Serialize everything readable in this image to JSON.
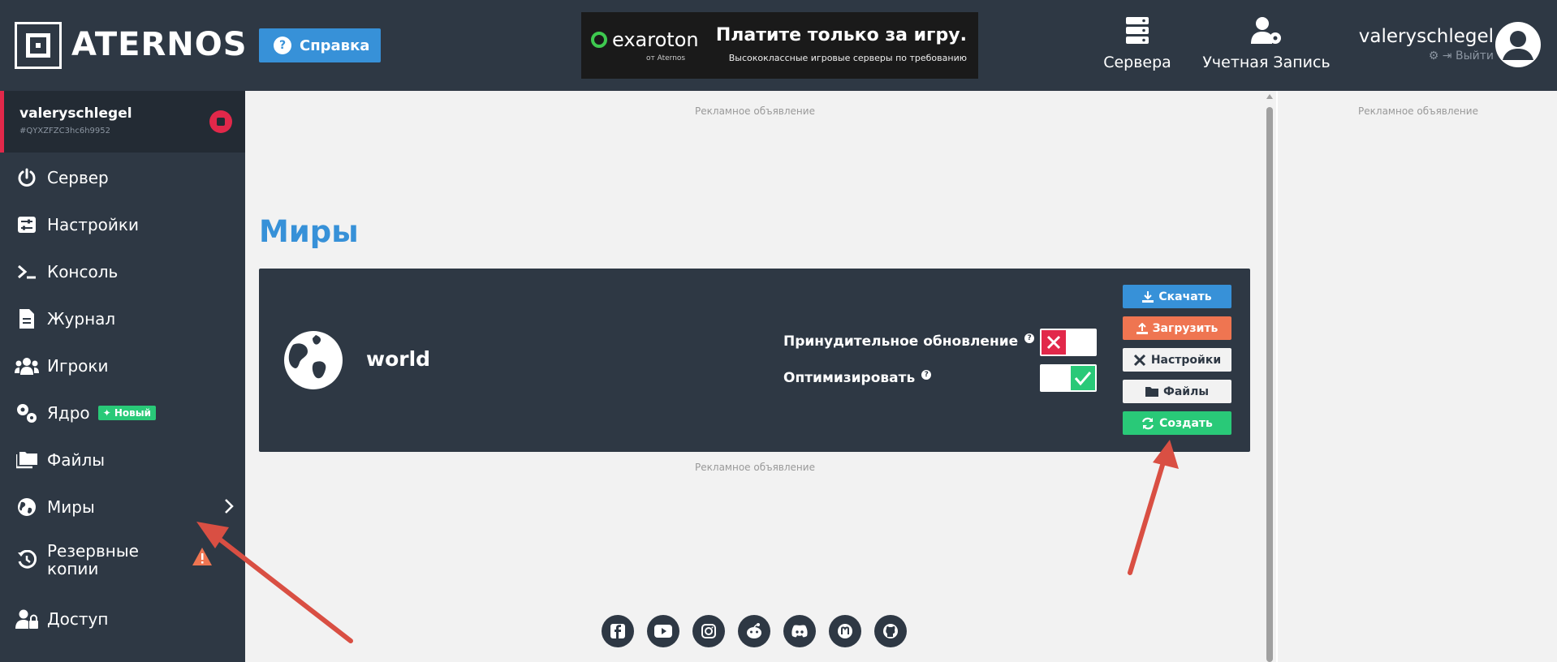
{
  "header": {
    "logo_text": "ATERNOS",
    "help_label": "Справка",
    "banner": {
      "brand": "exaroton",
      "brand_sub": "от Aternos",
      "title": "Платите только за игру.",
      "desc": "Высококлассные игровые серверы по требованию"
    },
    "nav": {
      "servers": "Сервера",
      "account": "Учетная Запись"
    },
    "user": {
      "name": "valeryschlegel",
      "logout": "Выйти"
    }
  },
  "sidebar": {
    "server_name": "valeryschlegel",
    "server_id": "#QYXZFZC3hc6h9952",
    "items": [
      {
        "label": "Сервер",
        "icon": "power-icon"
      },
      {
        "label": "Настройки",
        "icon": "sliders-icon"
      },
      {
        "label": "Консоль",
        "icon": "terminal-icon"
      },
      {
        "label": "Журнал",
        "icon": "document-icon"
      },
      {
        "label": "Игроки",
        "icon": "users-icon"
      },
      {
        "label": "Ядро",
        "icon": "gears-icon",
        "badge": "Новый"
      },
      {
        "label": "Файлы",
        "icon": "folders-icon"
      },
      {
        "label": "Миры",
        "icon": "globe-icon"
      },
      {
        "label": "Резервные копии",
        "icon": "history-icon"
      },
      {
        "label": "Доступ",
        "icon": "user-lock-icon"
      }
    ]
  },
  "main": {
    "ad_label": "Рекламное объявление",
    "title": "Миры",
    "world": {
      "name": "world",
      "force_update_label": "Принудительное обновление",
      "optimize_label": "Оптимизировать",
      "force_update_enabled": false,
      "optimize_enabled": true
    },
    "buttons": {
      "download": "Скачать",
      "upload": "Загрузить",
      "settings": "Настройки",
      "files": "Файлы",
      "create": "Создать"
    }
  },
  "footer": {
    "social": [
      "facebook-icon",
      "youtube-icon",
      "instagram-icon",
      "reddit-icon",
      "discord-icon",
      "mastodon-icon",
      "github-icon"
    ]
  },
  "colors": {
    "header_bg": "#2e3844",
    "accent_blue": "#3791d8",
    "red": "#e2284a",
    "green": "#29c978",
    "orange": "#ef7551",
    "annotation_arrow": "#d94f43"
  }
}
